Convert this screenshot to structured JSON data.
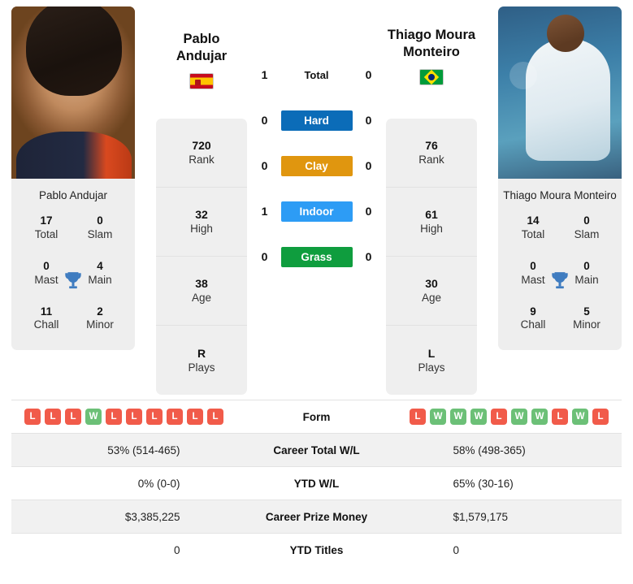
{
  "players": {
    "left": {
      "name_line1": "Pablo",
      "name_line2": "Andujar",
      "full_name": "Pablo Andujar",
      "flag": "spain-flag",
      "photo": "player-photo-left",
      "stats": [
        {
          "value": "720",
          "label": "Rank"
        },
        {
          "value": "32",
          "label": "High"
        },
        {
          "value": "38",
          "label": "Age"
        },
        {
          "value": "R",
          "label": "Plays"
        }
      ],
      "titles": [
        {
          "value": "17",
          "label": "Total"
        },
        {
          "value": "0",
          "label": "Slam"
        },
        {
          "value": "0",
          "label": "Mast"
        },
        {
          "value": "4",
          "label": "Main"
        },
        {
          "value": "11",
          "label": "Chall"
        },
        {
          "value": "2",
          "label": "Minor"
        }
      ],
      "form": [
        "L",
        "L",
        "L",
        "W",
        "L",
        "L",
        "L",
        "L",
        "L",
        "L"
      ],
      "career_total_wl": "53% (514-465)",
      "ytd_wl": "0% (0-0)",
      "career_prize_money": "$3,385,225",
      "ytd_titles": "0"
    },
    "right": {
      "name_line1": "Thiago Moura",
      "name_line2": "Monteiro",
      "full_name": "Thiago Moura Monteiro",
      "flag": "brazil-flag",
      "photo": "player-photo-right",
      "stats": [
        {
          "value": "76",
          "label": "Rank"
        },
        {
          "value": "61",
          "label": "High"
        },
        {
          "value": "30",
          "label": "Age"
        },
        {
          "value": "L",
          "label": "Plays"
        }
      ],
      "titles": [
        {
          "value": "14",
          "label": "Total"
        },
        {
          "value": "0",
          "label": "Slam"
        },
        {
          "value": "0",
          "label": "Mast"
        },
        {
          "value": "0",
          "label": "Main"
        },
        {
          "value": "9",
          "label": "Chall"
        },
        {
          "value": "5",
          "label": "Minor"
        }
      ],
      "form": [
        "L",
        "W",
        "W",
        "W",
        "L",
        "W",
        "W",
        "L",
        "W",
        "L"
      ],
      "career_total_wl": "58% (498-365)",
      "ytd_wl": "65% (30-16)",
      "career_prize_money": "$1,579,175",
      "ytd_titles": "0"
    }
  },
  "head_to_head": [
    {
      "label": "Total",
      "left": "1",
      "right": "0",
      "color": "none",
      "plain": true
    },
    {
      "label": "Hard",
      "left": "0",
      "right": "0",
      "color": "#0b6cb8",
      "plain": false
    },
    {
      "label": "Clay",
      "left": "0",
      "right": "0",
      "color": "#e0960f",
      "plain": false
    },
    {
      "label": "Indoor",
      "left": "1",
      "right": "0",
      "color": "#2d9cf5",
      "plain": false
    },
    {
      "label": "Grass",
      "left": "0",
      "right": "0",
      "color": "#0f9d3e",
      "plain": false
    }
  ],
  "comparison_rows": [
    {
      "label": "Form",
      "type": "form",
      "shade": false
    },
    {
      "label": "Career Total W/L",
      "type": "text",
      "shade": true,
      "left": "53% (514-465)",
      "right": "58% (498-365)"
    },
    {
      "label": "YTD W/L",
      "type": "text",
      "shade": false,
      "left": "0% (0-0)",
      "right": "65% (30-16)"
    },
    {
      "label": "Career Prize Money",
      "type": "text",
      "shade": true,
      "left": "$3,385,225",
      "right": "$1,579,175"
    },
    {
      "label": "YTD Titles",
      "type": "text",
      "shade": false,
      "left": "0",
      "right": "0"
    }
  ],
  "icons": {
    "trophy": "trophy-icon"
  }
}
